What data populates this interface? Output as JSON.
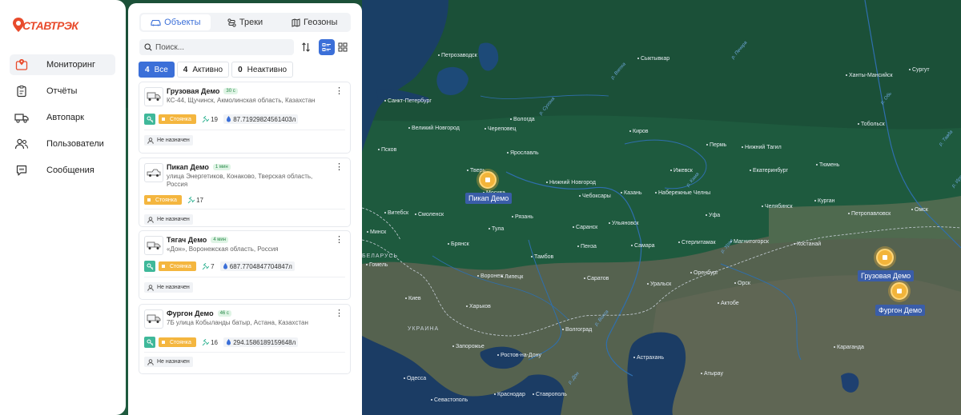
{
  "brand": {
    "logo_text": "СТАВТРЭК",
    "accent": "#e84b2c",
    "primary": "#3b6fd8",
    "status_color": "#f4b63f"
  },
  "nav": [
    {
      "label": "Мониторинг",
      "icon": "monitor-pin-icon",
      "active": true
    },
    {
      "label": "Отчёты",
      "icon": "clipboard-icon",
      "active": false
    },
    {
      "label": "Автопарк",
      "icon": "truck-icon",
      "active": false
    },
    {
      "label": "Пользователи",
      "icon": "users-icon",
      "active": false
    },
    {
      "label": "Сообщения",
      "icon": "chat-icon",
      "active": false
    }
  ],
  "tabs": [
    {
      "label": "Объекты",
      "icon": "car-icon",
      "active": true
    },
    {
      "label": "Треки",
      "icon": "route-icon",
      "active": false
    },
    {
      "label": "Геозоны",
      "icon": "map-icon",
      "active": false
    }
  ],
  "search": {
    "placeholder": "Поиск...",
    "value": ""
  },
  "filters": [
    {
      "count": "4",
      "label": "Все",
      "active": true
    },
    {
      "count": "4",
      "label": "Активно",
      "active": false
    },
    {
      "count": "0",
      "label": "Неактивно",
      "active": false
    }
  ],
  "vehicles": [
    {
      "name": "Грузовая Демо",
      "time": "30 с",
      "address": "КС-44, Щучинск, Акмолинская область, Казахстан",
      "status": "Стоянка",
      "satellites": "19",
      "fuel": "87.71929824561403л",
      "has_key": true,
      "assignee": "Не назначен"
    },
    {
      "name": "Пикап Демо",
      "time": "1 мин",
      "address": "улица Энергетиков, Конаково, Тверская область, Россия",
      "status": "Стоянка",
      "satellites": "17",
      "fuel": "",
      "has_key": false,
      "assignee": "Не назначен"
    },
    {
      "name": "Тягач Демо",
      "time": "4 мин",
      "address": "«Дон», Воронежская область, Россия",
      "status": "Стоянка",
      "satellites": "7",
      "fuel": "687.7704847704847л",
      "has_key": true,
      "assignee": "Не назначен"
    },
    {
      "name": "Фургон Демо",
      "time": "46 с",
      "address": "7Б улица Кобыланды батыр, Астана, Казахстан",
      "status": "Стоянка",
      "satellites": "16",
      "fuel": "294.1586189159648л",
      "has_key": true,
      "assignee": "Не назначен"
    }
  ],
  "map": {
    "markers": [
      {
        "label": "Пикап Демо"
      },
      {
        "label": "Грузовая Демо"
      },
      {
        "label": "Фургон Демо"
      }
    ],
    "cities": [
      "Петрозаводск",
      "Сыктывкар",
      "Санкт-Петербург",
      "Вологда",
      "Великий Новгород",
      "Череповец",
      "Киров",
      "Пермь",
      "Нижний Тагил",
      "Сургут",
      "Ханты-Мансийск",
      "Тобольск",
      "Псков",
      "Ярославль",
      "Ижевск",
      "Екатеринбург",
      "Тюмень",
      "Тверь",
      "Москва",
      "Нижний Новгород",
      "Чебоксары",
      "Казань",
      "Набережные Челны",
      "Курган",
      "Витебск",
      "Смоленск",
      "Рязань",
      "Саранск",
      "Ульяновск",
      "Уфа",
      "Челябинск",
      "Петропавловск",
      "Омск",
      "Минск",
      "Брянск",
      "Тула",
      "Пенза",
      "Самара",
      "Стерлитамак",
      "Магнитогорск",
      "Костанай",
      "Гомель",
      "Тамбов",
      "Липецк",
      "Киев",
      "Воронеж",
      "Саратов",
      "Оренбург",
      "Орск",
      "Уральск",
      "Харьков",
      "Актобе",
      "Волгоград",
      "Запорожье",
      "Ростов-на-Дону",
      "Астрахань",
      "Атырау",
      "Одесса",
      "Краснодар",
      "Ставрополь",
      "Севастополь",
      "Караганда"
    ],
    "countries": [
      "БЕЛАРУСЬ",
      "УКРАИНА"
    ],
    "rivers": [
      "р. Обь",
      "р. Кама",
      "р. Вятка",
      "р. Волга",
      "р. Дон",
      "р. Урал",
      "р. Сухона",
      "р. Печора",
      "р. Тавда",
      "р. Иртыш"
    ]
  }
}
